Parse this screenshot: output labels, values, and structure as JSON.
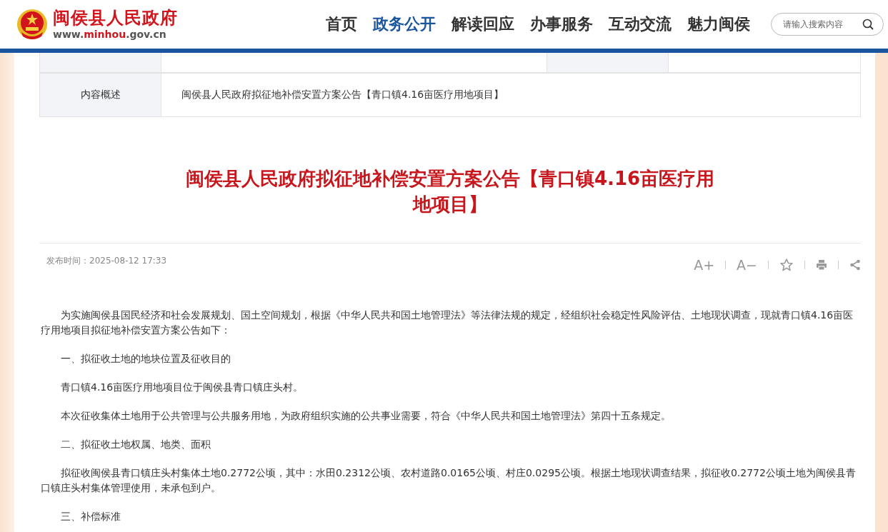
{
  "header": {
    "site_name": "闽侯县人民政府",
    "site_url": [
      {
        "text": "www.",
        "kind": "plain"
      },
      {
        "text": "minhou",
        "kind": "accent"
      },
      {
        "text": ".gov.cn",
        "kind": "plain"
      }
    ],
    "nav": [
      {
        "label": "首页",
        "selected": false
      },
      {
        "label": "政务公开",
        "selected": true
      },
      {
        "label": "解读回应",
        "selected": false
      },
      {
        "label": "办事服务",
        "selected": false
      },
      {
        "label": "互动交流",
        "selected": false
      },
      {
        "label": "魅力闽侯",
        "selected": false
      }
    ],
    "search": {
      "placeholder": "请输入搜索内容"
    }
  },
  "info_table": {
    "rows": [
      {
        "label": "内容概述",
        "value": "闽侯县人民政府拟征地补偿安置方案公告【青口镇4.16亩医疗用地项目】"
      }
    ]
  },
  "article": {
    "title": "闽侯县人民政府拟征地补偿安置方案公告【青口镇4.16亩医疗用地项目】",
    "published": "发布时间：2025-08-12 17:33",
    "tools": [
      {
        "kind": "text",
        "label": "A+"
      },
      {
        "kind": "text",
        "label": "A−"
      },
      {
        "kind": "star"
      },
      {
        "kind": "print"
      },
      {
        "kind": "share"
      }
    ],
    "paragraphs": [
      "为实施闽侯县国民经济和社会发展规划、国土空间规划，根据《中华人民共和国土地管理法》等法律法规的规定，经组织社会稳定性风险评估、土地现状调查，现就青口镇4.16亩医疗用地项目拟征地补偿安置方案公告如下：",
      "一、拟征收土地的地块位置及征收目的",
      "青口镇4.16亩医疗用地项目位于闽侯县青口镇庄头村。",
      "本次征收集体土地用于公共管理与公共服务用地，为政府组织实施的公共事业需要，符合《中华人民共和国土地管理法》第四十五条规定。",
      "二、拟征收土地权属、地类、面积",
      "拟征收闽侯县青口镇庄头村集体土地0.2772公顷，其中：水田0.2312公顷、农村道路0.0165公顷、村庄0.0295公顷。根据土地现状调查结果，拟征收0.2772公顷土地为闽侯县青口镇庄头村集体管理使用，未承包到户。",
      "三、补偿标准"
    ]
  }
}
